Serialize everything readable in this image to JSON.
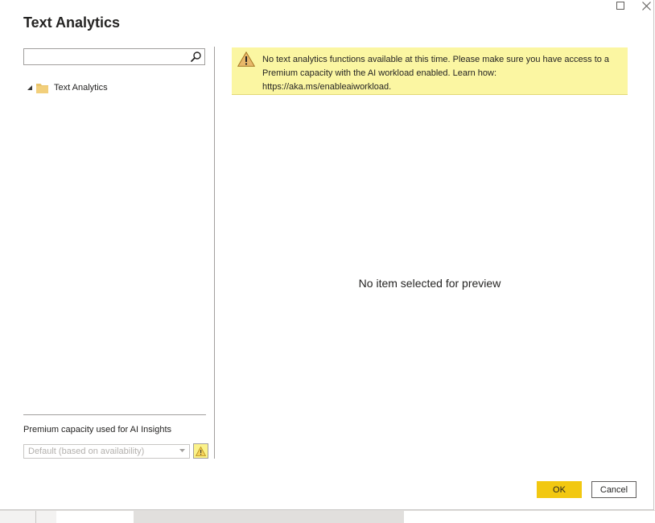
{
  "dialog": {
    "title": "Text Analytics"
  },
  "search": {
    "value": "",
    "placeholder": ""
  },
  "tree": {
    "items": [
      {
        "label": "Text Analytics",
        "expanded": true,
        "icon": "folder-icon"
      }
    ]
  },
  "capacity": {
    "label": "Premium capacity used for AI Insights",
    "selected": "Default (based on availability)"
  },
  "banner": {
    "message": "No text analytics functions available at this time. Please make sure you have access to a Premium capacity with the AI workload enabled. Learn how: https://aka.ms/enableaiworkload."
  },
  "preview": {
    "empty_text": "No item selected for preview"
  },
  "buttons": {
    "ok": "OK",
    "cancel": "Cancel"
  },
  "colors": {
    "accent": "#f2c811",
    "banner_bg": "#fbf6a2",
    "warning": "#fbf28a"
  }
}
